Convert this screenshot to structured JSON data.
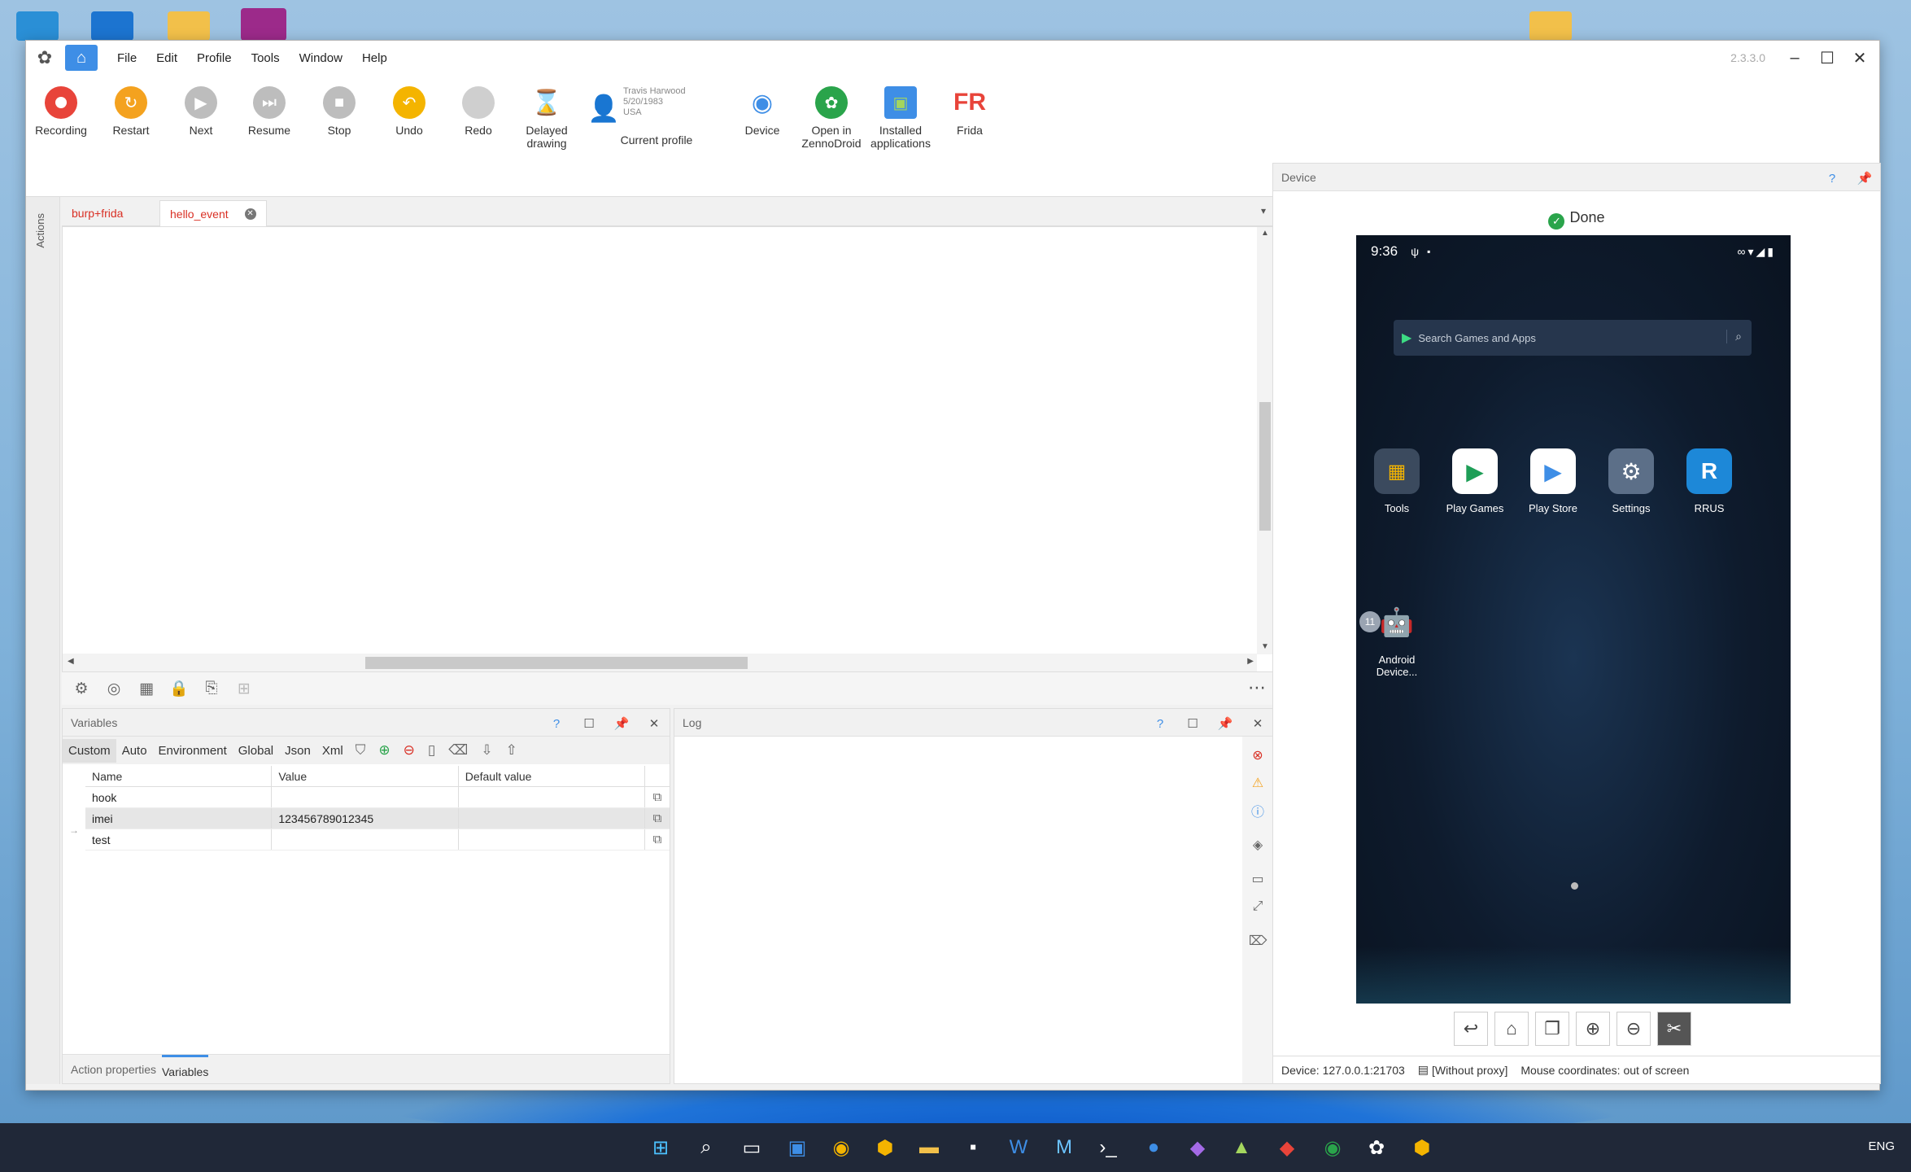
{
  "app": {
    "version": "2.3.3.0",
    "menu": [
      "File",
      "Edit",
      "Profile",
      "Tools",
      "Window",
      "Help"
    ]
  },
  "toolbar": {
    "recording": "Recording",
    "restart": "Restart",
    "next": "Next",
    "resume": "Resume",
    "stop": "Stop",
    "undo": "Undo",
    "redo": "Redo",
    "delayed_1": "Delayed",
    "delayed_2": "drawing",
    "device": "Device",
    "open_1": "Open in",
    "open_2": "ZennoDroid",
    "installed_1": "Installed",
    "installed_2": "applications",
    "frida": "Frida",
    "frida_logo": "FR"
  },
  "profile": {
    "name": "Travis Harwood",
    "dob": "5/20/1983",
    "country": "USA",
    "label": "Current profile"
  },
  "sidebar": {
    "actions": "Actions"
  },
  "tabs": [
    {
      "label": "burp+frida"
    },
    {
      "label": "hello_event"
    }
  ],
  "variables": {
    "title": "Variables",
    "tabs": [
      "Custom",
      "Auto",
      "Environment",
      "Global",
      "Json",
      "Xml"
    ],
    "columns": [
      "Name",
      "Value",
      "Default value"
    ],
    "rows": [
      {
        "name": "hook",
        "value": "",
        "default": ""
      },
      {
        "name": "imei",
        "value": "123456789012345",
        "default": ""
      },
      {
        "name": "test",
        "value": "",
        "default": ""
      }
    ],
    "bottom_tabs": [
      "Action properties",
      "Variables"
    ]
  },
  "log": {
    "title": "Log"
  },
  "device": {
    "title": "Device",
    "status": "Done",
    "phone": {
      "time": "9:36",
      "search_placeholder": "Search Games and Apps",
      "apps": [
        {
          "label": "Tools"
        },
        {
          "label": "Play Games"
        },
        {
          "label": "Play Store"
        },
        {
          "label": "Settings"
        },
        {
          "label": "RRUS"
        },
        {
          "label": "Android Device..."
        }
      ],
      "badge": "11",
      "rrus_logo": "R"
    },
    "footer": {
      "device": "Device: 127.0.0.1:21703",
      "proxy": "[Without proxy]",
      "mouse": "Mouse coordinates: out of screen"
    }
  },
  "taskbar": {
    "lang": "ENG"
  },
  "colors": {
    "accent": "#3e8ee6",
    "record": "#e8443a",
    "undo": "#f4b400",
    "green": "#2aa44b"
  }
}
